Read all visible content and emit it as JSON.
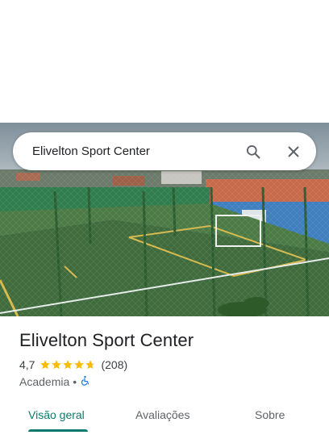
{
  "search": {
    "query": "Elivelton Sport Center"
  },
  "place": {
    "name": "Elivelton Sport Center",
    "rating": "4,7",
    "rating_stars": 4.7,
    "review_count": "(208)",
    "category": "Academia",
    "separator": "•"
  },
  "tabs": [
    {
      "label": "Visão geral",
      "active": true
    },
    {
      "label": "Avaliações",
      "active": false
    },
    {
      "label": "Sobre",
      "active": false
    }
  ],
  "colors": {
    "accent": "#0b7a6e",
    "star": "#fbbc04",
    "accessibility": "#1a73e8"
  },
  "icons": {
    "search": "search-icon",
    "close": "close-icon",
    "accessibility": "wheelchair-icon"
  }
}
